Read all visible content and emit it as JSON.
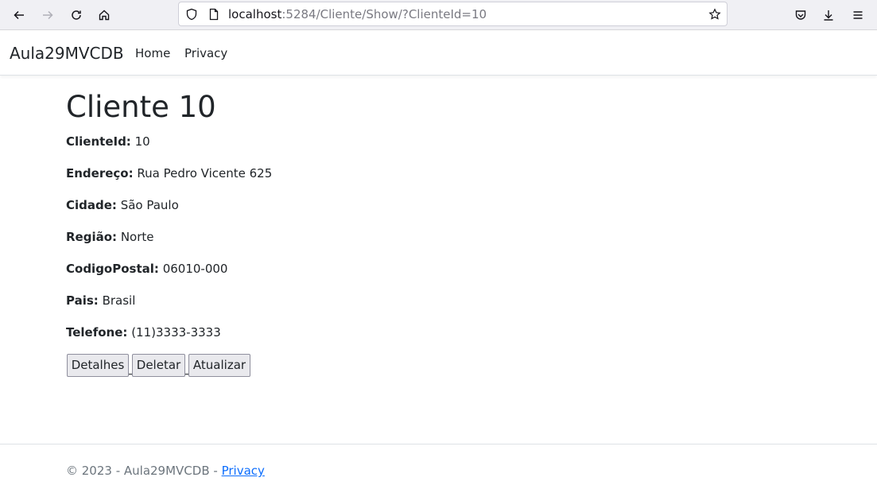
{
  "browser": {
    "url_host": "localhost",
    "url_path": ":5284/Cliente/Show/?ClienteId=10"
  },
  "navbar": {
    "brand": "Aula29MVCDB",
    "links": [
      "Home",
      "Privacy"
    ]
  },
  "main": {
    "title": "Cliente 10",
    "fields": [
      {
        "label": "ClienteId:",
        "value": "10"
      },
      {
        "label": "Endereço:",
        "value": "Rua Pedro Vicente 625"
      },
      {
        "label": "Cidade:",
        "value": "São Paulo"
      },
      {
        "label": "Região:",
        "value": "Norte"
      },
      {
        "label": "CodigoPostal:",
        "value": "06010-000"
      },
      {
        "label": "Pais:",
        "value": "Brasil"
      },
      {
        "label": "Telefone:",
        "value": "(11)3333-3333"
      }
    ],
    "buttons": [
      "Detalhes",
      "Deletar",
      "Atualizar"
    ]
  },
  "footer": {
    "text": "© 2023 - Aula29MVCDB - ",
    "link": "Privacy"
  },
  "colors": {
    "link": "#0d6efd",
    "muted": "#6c757d",
    "text": "#212529"
  }
}
